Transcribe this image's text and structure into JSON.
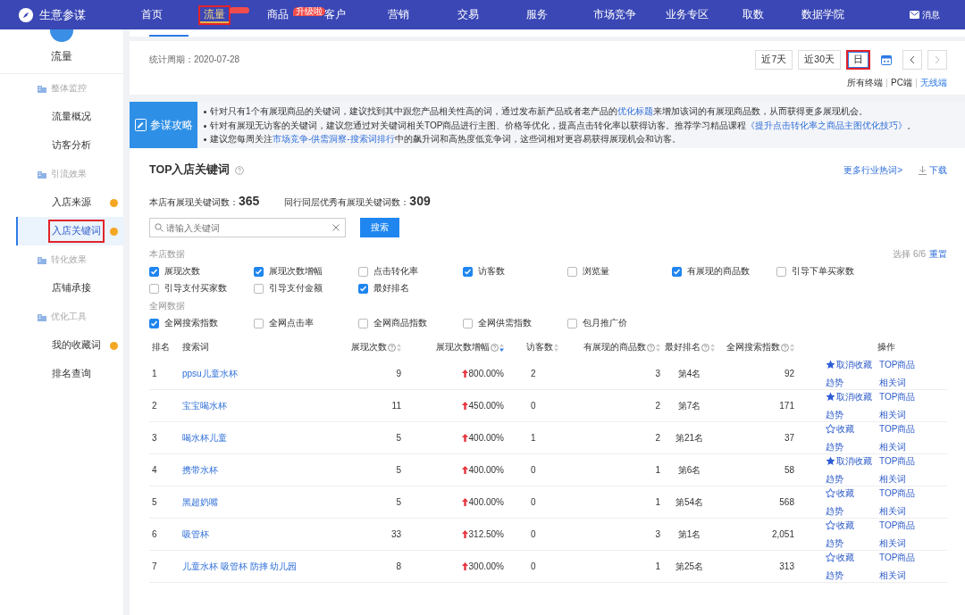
{
  "topnav": {
    "brand": "生意参谋",
    "items": [
      {
        "label": "首页",
        "selected": false,
        "annotated": false,
        "badge": false
      },
      {
        "label": "流量",
        "selected": true,
        "annotated": true,
        "badge": true
      },
      {
        "label": "商品",
        "selected": false,
        "annotated": false,
        "badge": true,
        "badge_text": "升级啦"
      },
      {
        "label": "客户",
        "selected": false,
        "annotated": false,
        "badge": false
      },
      {
        "label": "营销",
        "selected": false,
        "annotated": false,
        "badge": false
      },
      {
        "label": "交易",
        "selected": false,
        "annotated": false,
        "badge": false
      },
      {
        "label": "服务",
        "selected": false,
        "annotated": false,
        "badge": false
      },
      {
        "label": "市场竞争",
        "selected": false,
        "annotated": false,
        "badge": false
      },
      {
        "label": "业务专区",
        "selected": false,
        "annotated": false,
        "badge": false
      },
      {
        "label": "取数",
        "selected": false,
        "annotated": false,
        "badge": false
      },
      {
        "label": "数据学院",
        "selected": false,
        "annotated": false,
        "badge": false
      }
    ],
    "message": "消息"
  },
  "sidebar": {
    "title": "流量",
    "items": [
      {
        "kind": "section",
        "label": "整体监控"
      },
      {
        "kind": "link",
        "label": "流量概况",
        "selected": false,
        "dot": false,
        "annotated": false
      },
      {
        "kind": "link",
        "label": "访客分析",
        "selected": false,
        "dot": false,
        "annotated": false
      },
      {
        "kind": "section",
        "label": "引流效果"
      },
      {
        "kind": "link",
        "label": "入店来源",
        "selected": false,
        "dot": true,
        "annotated": false
      },
      {
        "kind": "link",
        "label": "入店关键词",
        "selected": true,
        "dot": true,
        "annotated": true
      },
      {
        "kind": "section",
        "label": "转化效果"
      },
      {
        "kind": "link",
        "label": "店铺承接",
        "selected": false,
        "dot": false,
        "annotated": false
      },
      {
        "kind": "section",
        "label": "优化工具"
      },
      {
        "kind": "link",
        "label": "我的收藏词",
        "selected": false,
        "dot": true,
        "annotated": false
      },
      {
        "kind": "link",
        "label": "排名查询",
        "selected": false,
        "dot": false,
        "annotated": false
      }
    ]
  },
  "period": {
    "label": "统计周期：",
    "value": "2020-07-28"
  },
  "ranges": [
    {
      "label": "近7天",
      "selected": false,
      "annotated": false
    },
    {
      "label": "近30天",
      "selected": false,
      "annotated": false
    },
    {
      "label": "日",
      "selected": true,
      "annotated": true
    }
  ],
  "terminals": [
    {
      "label": "所有终端",
      "selected": false
    },
    {
      "label": "PC端",
      "selected": false
    },
    {
      "label": "无线端",
      "selected": true
    }
  ],
  "tips": {
    "title": "参谋攻略",
    "lines": [
      [
        {
          "text": "针对只有1个有展现商品的关键词，建议找到其中跟您产品相关性高的词，通过发布新产品或者老产品的",
          "link": false
        },
        {
          "text": "优化标题",
          "link": true
        },
        {
          "text": "来增加该词的有展现商品数，从而获得更多展现机会。",
          "link": false
        }
      ],
      [
        {
          "text": "针对有展现无访客的关键词，建议您通过对关键词相关TOP商品进行主图、价格等优化，提高点击转化率以获得访客。推荐学习精品课程",
          "link": false
        },
        {
          "text": "《提升点击转化率之商品主图优化技巧》",
          "link": true
        },
        {
          "text": "。",
          "link": false
        }
      ],
      [
        {
          "text": "建议您每周关注",
          "link": false
        },
        {
          "text": "市场竞争-供需洞察-搜索词排行",
          "link": true
        },
        {
          "text": "中的飙升词和高热度低竞争词，这些词相对更容易获得展现机会和访客。",
          "link": false
        }
      ]
    ]
  },
  "section": {
    "title": "TOP入店关键词",
    "more": "更多行业热词>",
    "download": "下载"
  },
  "stats": [
    {
      "label": "本店有展现关键词数：",
      "value": "365"
    },
    {
      "label": "同行同层优秀有展现关键词数：",
      "value": "309"
    }
  ],
  "search": {
    "placeholder": "请输入关键词",
    "button": "搜索"
  },
  "filters": {
    "summary": "选择 6/6",
    "reset": "重置",
    "groups": [
      {
        "title": "本店数据",
        "items": [
          {
            "label": "展现次数",
            "checked": true
          },
          {
            "label": "展现次数增幅",
            "checked": true
          },
          {
            "label": "点击转化率",
            "checked": false
          },
          {
            "label": "访客数",
            "checked": true
          },
          {
            "label": "浏览量",
            "checked": false
          },
          {
            "label": "有展现的商品数",
            "checked": true
          },
          {
            "label": "引导下单买家数",
            "checked": false
          },
          {
            "label": "引导支付买家数",
            "checked": false
          },
          {
            "label": "引导支付金额",
            "checked": false
          },
          {
            "label": "最好排名",
            "checked": true
          }
        ]
      },
      {
        "title": "全网数据",
        "items": [
          {
            "label": "全网搜索指数",
            "checked": true
          },
          {
            "label": "全网点击率",
            "checked": false
          },
          {
            "label": "全网商品指数",
            "checked": false
          },
          {
            "label": "全网供需指数",
            "checked": false
          },
          {
            "label": "包月推广价",
            "checked": false
          }
        ]
      }
    ]
  },
  "table": {
    "columns": [
      {
        "label": "排名",
        "help": false,
        "sortable": false
      },
      {
        "label": "搜索词",
        "help": false,
        "sortable": false
      },
      {
        "label": "展现次数",
        "help": true,
        "sortable": true,
        "sorted": false
      },
      {
        "label": "展现次数增幅",
        "help": true,
        "sortable": true,
        "sorted": true
      },
      {
        "label": "访客数",
        "help": false,
        "sortable": true,
        "sorted": false
      },
      {
        "label": "有展现的商品数",
        "help": true,
        "sortable": true,
        "sorted": false
      },
      {
        "label": "最好排名",
        "help": true,
        "sortable": true,
        "sorted": false
      },
      {
        "label": "全网搜索指数",
        "help": true,
        "sortable": true,
        "sorted": false
      },
      {
        "label": "操作",
        "help": false,
        "sortable": false
      }
    ],
    "rows": [
      {
        "rank": "1",
        "keyword": "ppsu儿童水杯",
        "impressions": "9",
        "growth": "800.00%",
        "visitors": "2",
        "products": "3",
        "best_rank": "第4名",
        "index": "92",
        "favorited": true,
        "fav_label": "取消收藏",
        "top": "TOP商品",
        "trend": "趋势",
        "related": "相关词"
      },
      {
        "rank": "2",
        "keyword": "宝宝喝水杯",
        "impressions": "11",
        "growth": "450.00%",
        "visitors": "0",
        "products": "2",
        "best_rank": "第7名",
        "index": "171",
        "favorited": true,
        "fav_label": "取消收藏",
        "top": "TOP商品",
        "trend": "趋势",
        "related": "相关词"
      },
      {
        "rank": "3",
        "keyword": "喝水杯儿童",
        "impressions": "5",
        "growth": "400.00%",
        "visitors": "1",
        "products": "2",
        "best_rank": "第21名",
        "index": "37",
        "favorited": false,
        "fav_label": "收藏",
        "top": "TOP商品",
        "trend": "趋势",
        "related": "相关词"
      },
      {
        "rank": "4",
        "keyword": "携带水杯",
        "impressions": "5",
        "growth": "400.00%",
        "visitors": "0",
        "products": "1",
        "best_rank": "第6名",
        "index": "58",
        "favorited": true,
        "fav_label": "取消收藏",
        "top": "TOP商品",
        "trend": "趋势",
        "related": "相关词"
      },
      {
        "rank": "5",
        "keyword": "黑超奶嘴",
        "impressions": "5",
        "growth": "400.00%",
        "visitors": "0",
        "products": "1",
        "best_rank": "第54名",
        "index": "568",
        "favorited": false,
        "fav_label": "收藏",
        "top": "TOP商品",
        "trend": "趋势",
        "related": "相关词"
      },
      {
        "rank": "6",
        "keyword": "吸管杯",
        "impressions": "33",
        "growth": "312.50%",
        "visitors": "0",
        "products": "3",
        "best_rank": "第1名",
        "index": "2,051",
        "favorited": false,
        "fav_label": "收藏",
        "top": "TOP商品",
        "trend": "趋势",
        "related": "相关词"
      },
      {
        "rank": "7",
        "keyword": "儿童水杯 吸管杯 防摔 幼儿园",
        "impressions": "8",
        "growth": "300.00%",
        "visitors": "0",
        "products": "1",
        "best_rank": "第25名",
        "index": "313",
        "favorited": false,
        "fav_label": "收藏",
        "top": "TOP商品",
        "trend": "趋势",
        "related": "相关词"
      }
    ]
  }
}
